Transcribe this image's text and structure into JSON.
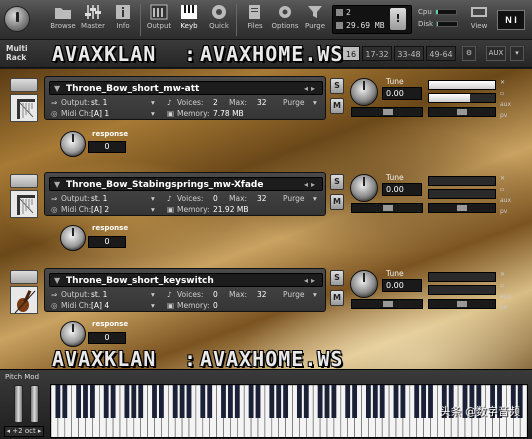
{
  "toolbar": {
    "buttons": [
      {
        "label": "Browse",
        "icon": "folder-icon"
      },
      {
        "label": "Master",
        "icon": "mixer-icon"
      },
      {
        "label": "Info",
        "icon": "info-icon"
      },
      {
        "label": "Output",
        "icon": "output-icon"
      },
      {
        "label": "Keyb",
        "icon": "keyboard-icon"
      },
      {
        "label": "Quick",
        "icon": "quick-icon"
      },
      {
        "label": "Files",
        "icon": "files-icon"
      },
      {
        "label": "Options",
        "icon": "gear-icon"
      },
      {
        "label": "Purge",
        "icon": "purge-icon"
      }
    ],
    "voices": "2",
    "memory": "29.69 MB",
    "warning": "!",
    "cpu_label": "Cpu",
    "disk_label": "Disk",
    "view_label": "View",
    "ni_logo": "N I"
  },
  "rack": {
    "label_line1": "Multi",
    "label_line2": "Rack",
    "tabs": [
      "16",
      "17-32",
      "33-48",
      "49-64"
    ],
    "aux": "AUX"
  },
  "instruments": [
    {
      "name": "Throne_Bow_short_mw-att",
      "output_label": "Output:",
      "output": "st. 1",
      "voices_label": "Voices:",
      "voices": "2",
      "max_label": "Max:",
      "max": "32",
      "purge": "Purge",
      "midi_label": "Midi Ch:",
      "midi": "[A]  1",
      "memory_label": "Memory:",
      "memory": "7.78 MB",
      "tune_label": "Tune",
      "tune": "0.00",
      "response_label": "response",
      "response": "0",
      "solo": "S",
      "mute": "M",
      "vol_levels": [
        1.0,
        0.62
      ]
    },
    {
      "name": "Throne_Bow_Stabingsprings_mw-Xfade",
      "output_label": "Output:",
      "output": "st. 1",
      "voices_label": "Voices:",
      "voices": "0",
      "max_label": "Max:",
      "max": "32",
      "purge": "Purge",
      "midi_label": "Midi Ch:",
      "midi": "[A]  2",
      "memory_label": "Memory:",
      "memory": "21.92 MB",
      "tune_label": "Tune",
      "tune": "0.00",
      "response_label": "response",
      "response": "0",
      "solo": "S",
      "mute": "M",
      "vol_levels": [
        0.0,
        0.0
      ]
    },
    {
      "name": "Throne_Bow_short_keyswitch",
      "output_label": "Output:",
      "output": "st. 1",
      "voices_label": "Voices:",
      "voices": "0",
      "max_label": "Max:",
      "max": "32",
      "purge": "Purge",
      "midi_label": "Midi Ch:",
      "midi": "[A]  4",
      "memory_label": "Memory:",
      "memory": "0",
      "tune_label": "Tune",
      "tune": "0.00",
      "response_label": "response",
      "response": "0",
      "solo": "S",
      "mute": "M",
      "vol_levels": [
        0.0,
        0.0
      ]
    }
  ],
  "watermark": {
    "left": "AVAXKLAN",
    "sep": ":",
    "right": "AVAXHOME.WS"
  },
  "keyboard": {
    "pitch_mod": "Pitch Mod",
    "octave": "+2 oct",
    "credit": "头条 @数字音频"
  }
}
